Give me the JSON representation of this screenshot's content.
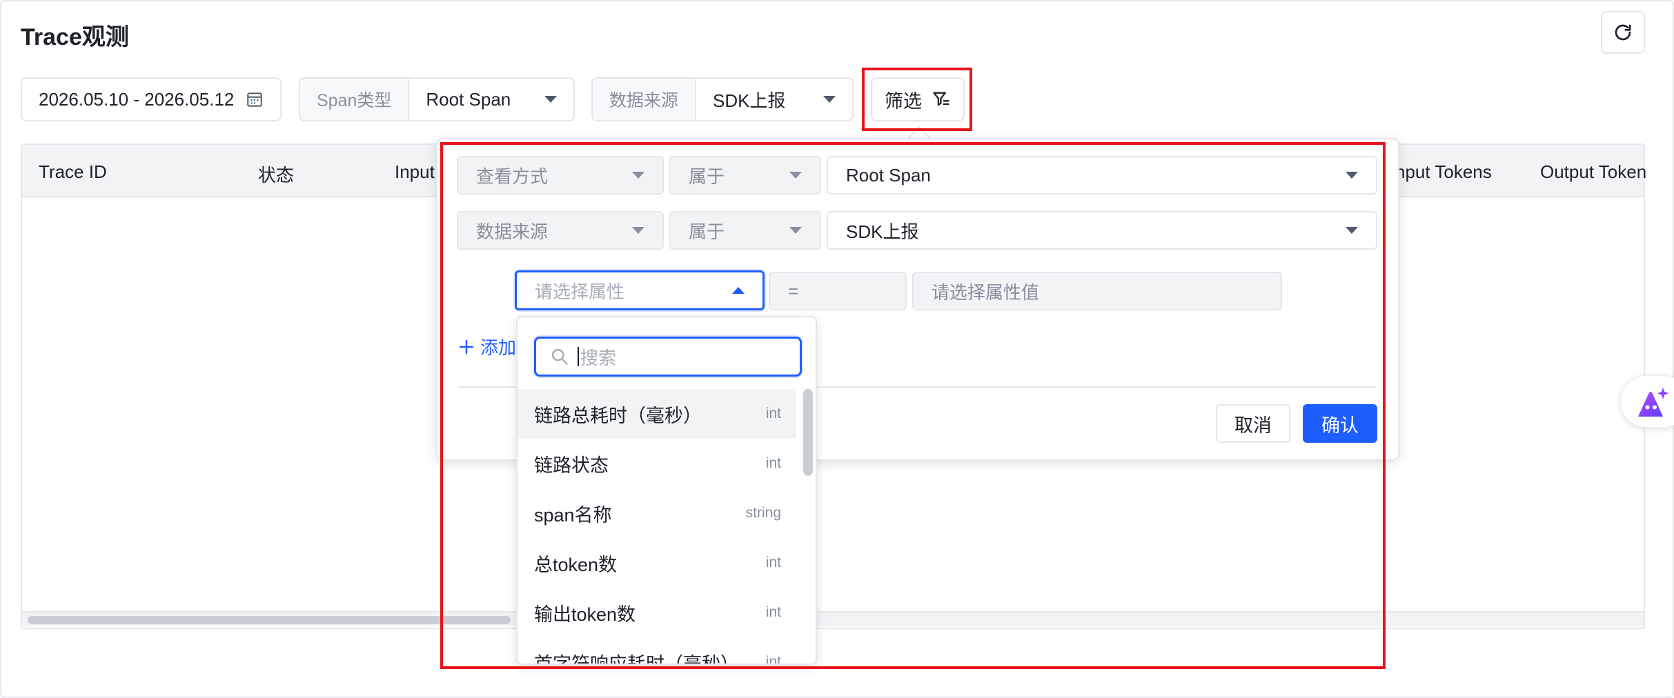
{
  "page": {
    "title": "Trace观测"
  },
  "toolbar": {
    "date_range": "2026.05.10 - 2026.05.12",
    "span_type": {
      "label": "Span类型",
      "value": "Root Span"
    },
    "data_source": {
      "label": "数据来源",
      "value": "SDK上报"
    },
    "filter_label": "筛选"
  },
  "table": {
    "columns": [
      {
        "label": "Trace ID"
      },
      {
        "label": "状态"
      },
      {
        "label": "Input"
      },
      {
        "label": "nput Tokens"
      },
      {
        "label": "Output Token"
      }
    ]
  },
  "filter_panel": {
    "rows": [
      {
        "field": "查看方式",
        "operator": "属于",
        "value": "Root Span"
      },
      {
        "field": "数据来源",
        "operator": "属于",
        "value": "SDK上报"
      }
    ],
    "new_row": {
      "attribute_placeholder": "请选择属性",
      "operator": "=",
      "value_placeholder": "请选择属性值"
    },
    "add_label": "添加",
    "cancel_label": "取消",
    "confirm_label": "确认"
  },
  "attribute_dropdown": {
    "search_placeholder": "搜索",
    "options": [
      {
        "name": "链路总耗时（毫秒）",
        "type": "int"
      },
      {
        "name": "链路状态",
        "type": "int"
      },
      {
        "name": "span名称",
        "type": "string"
      },
      {
        "name": "总token数",
        "type": "int"
      },
      {
        "name": "输出token数",
        "type": "int"
      },
      {
        "name": "首字符响应耗时（毫秒）",
        "type": "int"
      }
    ]
  },
  "colors": {
    "accent": "#1e5eff",
    "highlight_box": "#e8141b",
    "border": "#e5e6eb"
  }
}
